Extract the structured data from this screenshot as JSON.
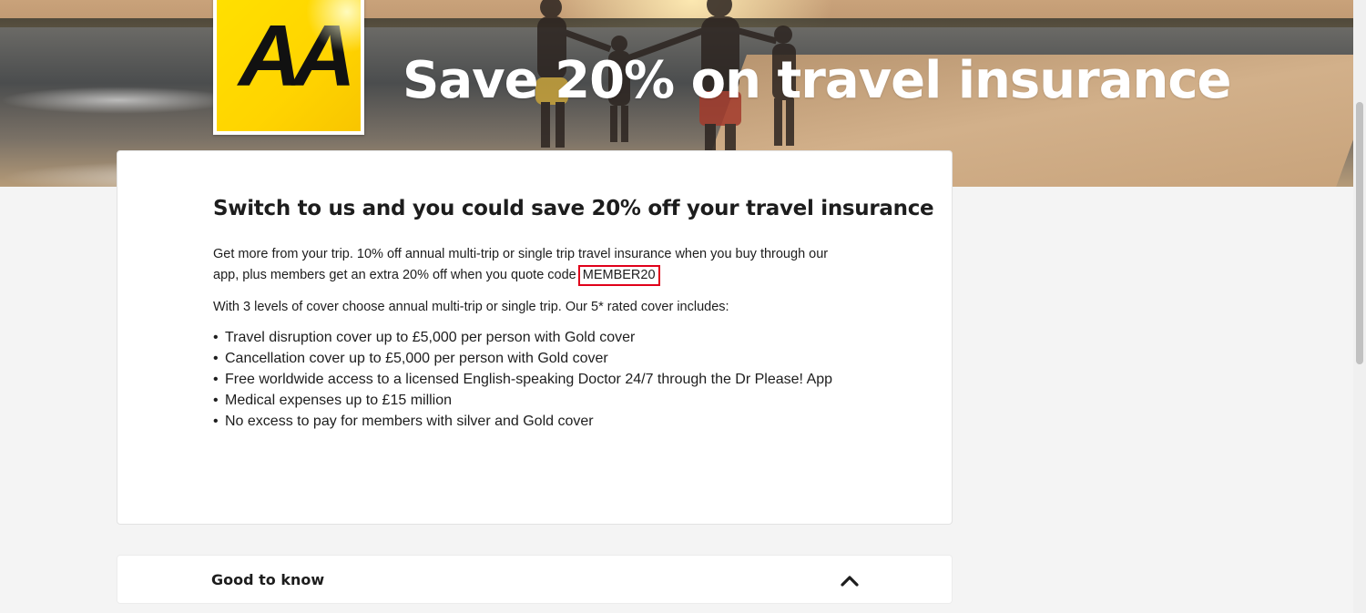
{
  "hero": {
    "title": "Save 20% on travel insurance"
  },
  "logo": {
    "text": "AA",
    "icon": "aa-logo"
  },
  "offer": {
    "heading": "Switch to us and you could save 20% off your travel insurance",
    "intro_text": "Get more from your trip. 10% off annual multi-trip or single trip travel insurance when you buy through our app, plus members get an extra 20% off when you quote code",
    "promo_code": "MEMBER20",
    "levels_text": "With 3 levels of cover choose annual multi-trip or single trip. Our 5* rated cover includes:",
    "bullets": [
      "Travel disruption cover up to £5,000 per person with Gold cover",
      "Cancellation cover up to £5,000 per person with Gold cover",
      "Free worldwide access to a licensed English-speaking Doctor 24/7 through the Dr Please! App",
      "Medical expenses up to £15 million",
      "No excess to pay for members with silver and Gold cover"
    ],
    "bullet_char": "•"
  },
  "accordion": {
    "label": "Good to know",
    "icon": "chevron-up-icon"
  },
  "colors": {
    "brand_yellow": "#ffd400",
    "highlight_red": "#e0001a",
    "page_bg": "#f4f4f4"
  }
}
